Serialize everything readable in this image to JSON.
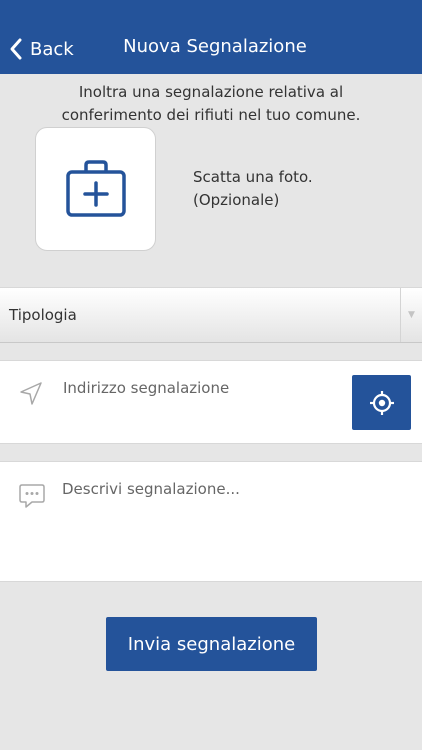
{
  "navbar": {
    "back_label": "Back",
    "title": "Nuova Segnalazione"
  },
  "intro": {
    "line1": "Inoltra una segnalazione relativa al",
    "line2": "conferimento dei rifiuti nel tuo comune."
  },
  "photo": {
    "icon": "camera-plus-icon",
    "line1": "Scatta una foto.",
    "line2": "(Opzionale)"
  },
  "tipologia": {
    "selected": "Tipologia"
  },
  "address": {
    "icon": "navigation-arrow-icon",
    "placeholder": "Indirizzo segnalazione",
    "locate_icon": "locate-crosshair-icon"
  },
  "description": {
    "icon": "chat-bubble-icon",
    "placeholder": "Descrivi segnalazione..."
  },
  "submit": {
    "label": "Invia segnalazione"
  },
  "colors": {
    "primary": "#24539a",
    "background": "#e6e6e6"
  }
}
